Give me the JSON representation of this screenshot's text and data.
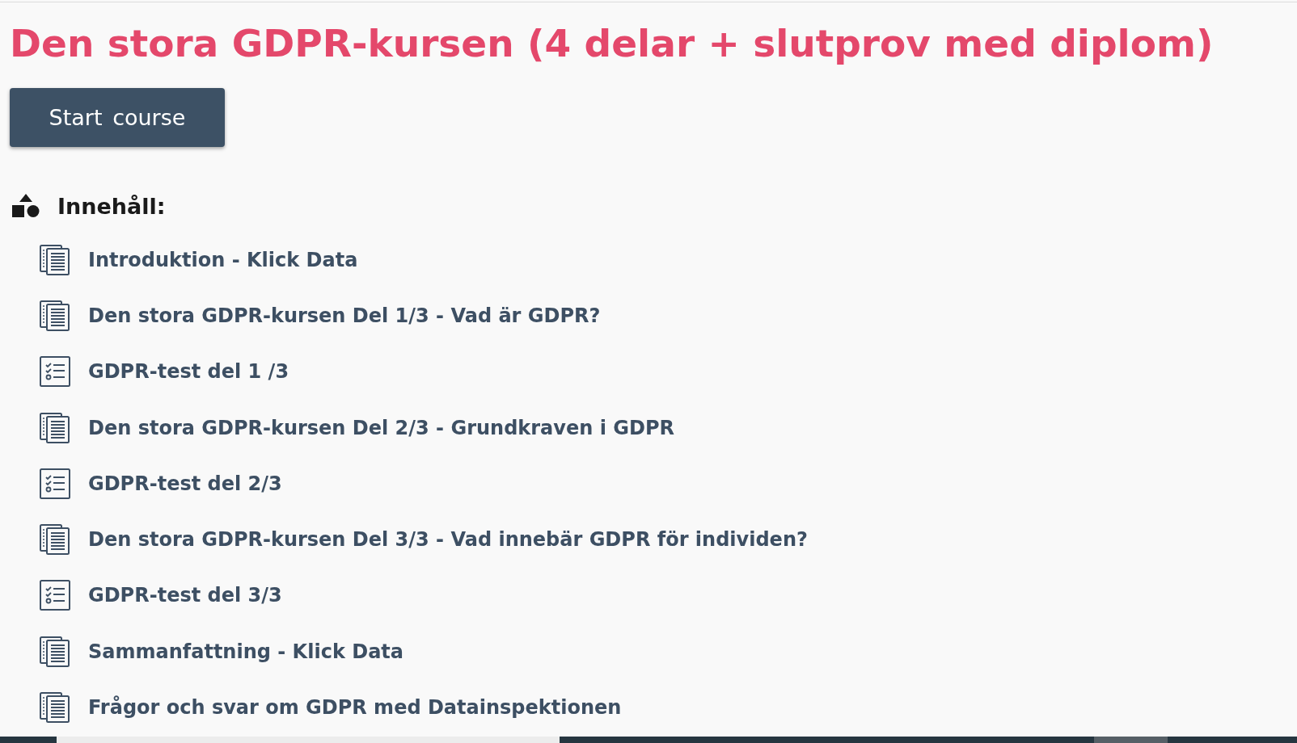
{
  "course": {
    "title": "Den stora GDPR-kursen (4 delar + slutprov med diplom)",
    "start_button": "Start course"
  },
  "contents": {
    "heading": "Innehåll:",
    "items": [
      {
        "kind": "page",
        "label": "Introduktion - Klick Data"
      },
      {
        "kind": "page",
        "label": "Den stora GDPR-kursen Del 1/3 - Vad är GDPR?"
      },
      {
        "kind": "quiz",
        "label": "GDPR-test del 1 /3"
      },
      {
        "kind": "page",
        "label": "Den stora GDPR-kursen Del 2/3 - Grundkraven i GDPR"
      },
      {
        "kind": "quiz",
        "label": "GDPR-test del 2/3"
      },
      {
        "kind": "page",
        "label": "Den stora GDPR-kursen Del 3/3 - Vad innebär GDPR för individen?"
      },
      {
        "kind": "quiz",
        "label": "GDPR-test del 3/3"
      },
      {
        "kind": "page",
        "label": "Sammanfattning - Klick Data"
      },
      {
        "kind": "page",
        "label": "Frågor och svar om GDPR med Datainspektionen"
      }
    ]
  }
}
